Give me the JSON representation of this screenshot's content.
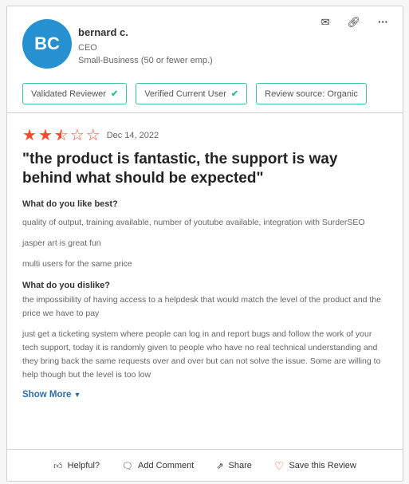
{
  "reviewer": {
    "initials": "BC",
    "name": "bernard c.",
    "role": "CEO",
    "company_size": "Small-Business (50 or fewer emp.)",
    "avatar_color": "#2591d0"
  },
  "actions": {
    "email_icon": "envelope-icon",
    "link_icon": "link-icon",
    "more_icon": "ellipsis-icon"
  },
  "badges": [
    {
      "label": "Validated Reviewer",
      "checked": true
    },
    {
      "label": "Verified Current User",
      "checked": true
    },
    {
      "label": "Review source: Organic",
      "checked": false
    }
  ],
  "review": {
    "rating": 2.5,
    "max_rating": 5,
    "star_color": "#ff492c",
    "date": "Dec 14, 2022",
    "title": "\"the product is fantastic, the support is way behind what should be expected\"",
    "like_heading": "What do you like best?",
    "like": [
      "quality of output, training available, number of youtube available, integration with SurderSEO",
      "jasper art is great fun",
      "multi users for the same price"
    ],
    "dislike_heading": "What do you dislike?",
    "dislike": [
      "the impossibility of having access to a helpdesk that would match the level of the product and the price we have to pay",
      "just get a ticketing system where people can log in and report bugs and follow the work of your tech support, today it is randomly given to people who have no real technical understanding and they bring back the same requests over and over but can not solve the issue. Some are willing to help though but the level is too low"
    ],
    "show_more": "Show More"
  },
  "footer": {
    "helpful": "Helpful?",
    "comment": "Add Comment",
    "share": "Share",
    "save": "Save this Review"
  }
}
